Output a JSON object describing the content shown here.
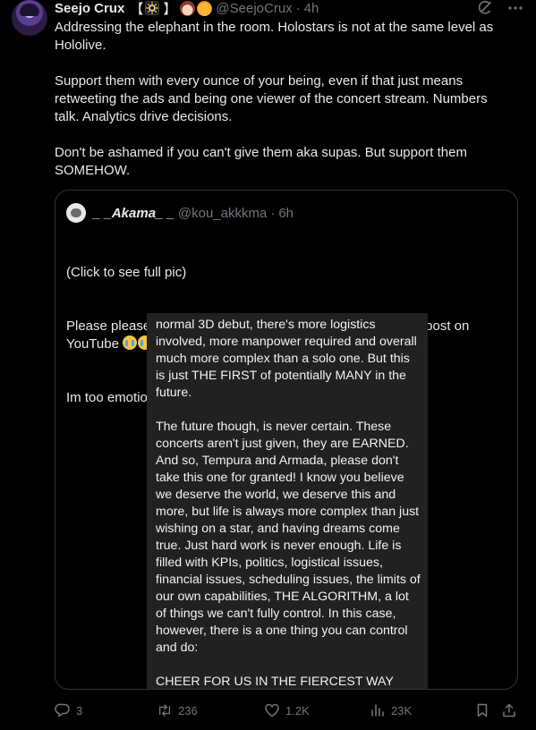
{
  "author": {
    "name": "Seejo Crux",
    "bracket_open": "【",
    "bracket_close": "】",
    "handle": "@SeejoCrux",
    "separator": "·",
    "time": "4h",
    "icons": [
      "sun-icon",
      "woman-face-emoji",
      "cat-face-emoji"
    ]
  },
  "top_icons": [
    "grok-icon",
    "more-icon"
  ],
  "tweet_text": "Addressing the elephant in the room. Holostars is not at the same level as Hololive.\n\nSupport them with every ounce of your being, even if that just means retweeting the ads and being one viewer of the concert stream. Numbers talk. Analytics drive decisions.\n\nDon't be ashamed if you can't give them aka supas. But support them SOMEHOW.",
  "quote": {
    "name": "_ _Akama_ _",
    "handle": "@kou_akkkma",
    "separator": "·",
    "time": "6h",
    "line1": "(Click to see full pic)",
    "line2": "Please please pleeeease go to read Tavi's latest community post on YouTube ",
    "line3": "Im too emotional I need to lay down and cry all night...",
    "emoji": "loudly-crying-face-emoji",
    "image_text": "normal 3D debut, there's more logistics involved, more manpower required and overall much more complex than a solo one. But this is just THE FIRST of potentially MANY in the future.\n\nThe future though, is never certain. These concerts aren't just given, they are EARNED. And so, Tempura and Armada, please don't take this one for granted! I know you believe we deserve the world, we deserve this and more, but life is always more complex than just wishing on a star, and having dreams come true. Just hard work is never enough. Life is filled with KPIs, politics, logistical issues, financial issues, scheduling issues, the limits of our own capabilities, THE ALGORITHM, a lot of things we can't fully control. In this case, however, there is a one thing you can control and do:\n\nCHEER FOR US IN THE FIERCEST WAY YOU"
  },
  "actions": {
    "replies": "3",
    "reposts": "236",
    "likes": "1.2K",
    "views": "23K"
  },
  "colors": {
    "background": "#000000",
    "text": "#e7e9ea",
    "muted": "#71767b",
    "border": "#2f3336",
    "image_bg": "#212121"
  }
}
